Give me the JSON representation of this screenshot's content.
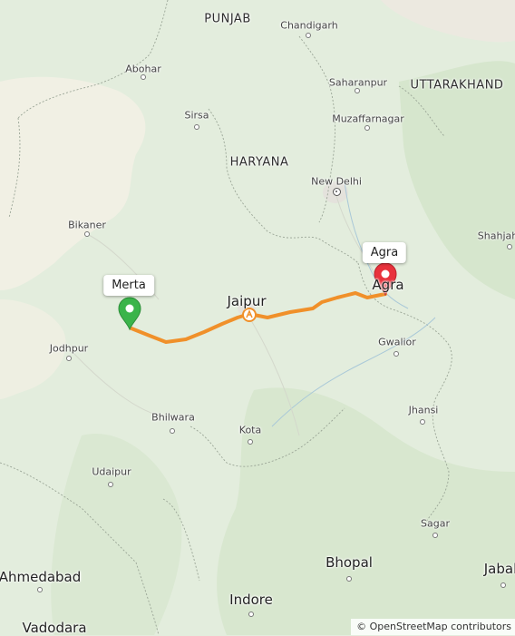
{
  "map": {
    "states": [
      "PUNJAB",
      "HARYANA",
      "UTTARAKHAND"
    ],
    "cities": [
      "Chandigarh",
      "Abohar",
      "Saharanpur",
      "Sirsa",
      "Muzaffarnagar",
      "New Delhi",
      "Bikaner",
      "Shahjahanpur",
      "Jaipur",
      "Agra",
      "Jodhpur",
      "Gwalior",
      "Bhilwara",
      "Jhansi",
      "Kota",
      "Udaipur",
      "Sagar",
      "Ahmedabad",
      "Bhopal",
      "Jabalpur",
      "Indore",
      "Vadodara"
    ],
    "route": {
      "start": "Merta",
      "end": "Agra",
      "color": "#f0902a",
      "start_marker_color": "#3bb44a",
      "end_marker_color": "#e8313c",
      "via_icon": "toll-icon"
    },
    "attribution": "© OpenStreetMap contributors"
  },
  "labels": {
    "state_punjab": "PUNJAB",
    "state_haryana": "HARYANA",
    "state_uttarakhand": "UTTARAKHAND",
    "city_chandigarh": "Chandigarh",
    "city_abohar": "Abohar",
    "city_saharanpur": "Saharanpur",
    "city_sirsa": "Sirsa",
    "city_muzaffarnagar": "Muzaffarnagar",
    "city_new_delhi": "New Delhi",
    "city_bikaner": "Bikaner",
    "city_shahjahanpur": "Shahjah",
    "city_jaipur": "Jaipur",
    "city_agra": "Agra",
    "city_jodhpur": "Jodhpur",
    "city_gwalior": "Gwalior",
    "city_bhilwara": "Bhilwara",
    "city_jhansi": "Jhansi",
    "city_kota": "Kota",
    "city_udaipur": "Udaipur",
    "city_sagar": "Sagar",
    "city_ahmedabad": "Ahmedabad",
    "city_bhopal": "Bhopal",
    "city_jabalpur": "Jabal",
    "city_indore": "Indore",
    "city_vadodara": "Vadodara",
    "start_callout": "Merta",
    "end_callout": "Agra",
    "attribution": "© OpenStreetMap contributors"
  }
}
